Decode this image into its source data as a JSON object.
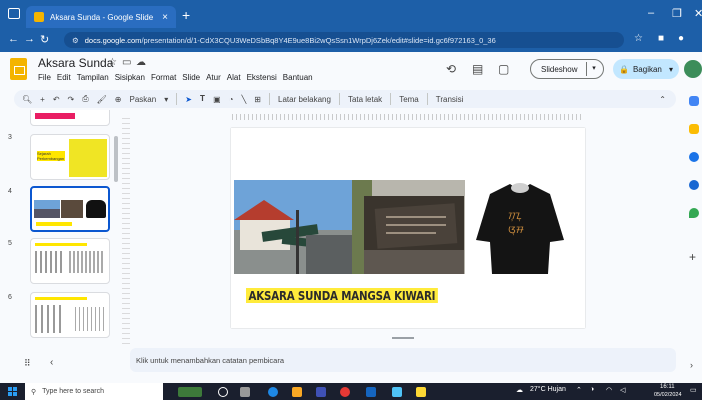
{
  "browser": {
    "tab_title": "Aksara Sunda - Google Slide",
    "tab_close": "×",
    "new_tab": "+",
    "url_domain": "docs.google.com",
    "url_path": "/presentation/d/1-CdX3CQU3WeDSbBq8Y4E9ue8Bi2wQsSsn1WrpDj6Zek/edit#slide=id.gc6f972163_0_36",
    "minimize": "–",
    "maximize": "❐",
    "close": "✕"
  },
  "doc": {
    "title": "Aksara Sunda",
    "menus": [
      "File",
      "Edit",
      "Tampilan",
      "Sisipkan",
      "Format",
      "Slide",
      "Atur",
      "Alat",
      "Ekstensi",
      "Bantuan"
    ],
    "slideshow_label": "Slideshow",
    "share_label": "Bagikan"
  },
  "toolbar": {
    "zoom_label": "Paskan",
    "background_label": "Latar belakang",
    "layout_label": "Tata letak",
    "theme_label": "Tema",
    "transition_label": "Transisi"
  },
  "filmstrip": {
    "slide_numbers": [
      "3",
      "4",
      "5",
      "6"
    ],
    "slide3_text": "Sejarah Perkembangan"
  },
  "slide": {
    "title": "AKSARA SUNDA MANGSA KIWARI",
    "shirt_text_line1": "ᮊᮥᮔᮥ",
    "shirt_text_line2": "ᮃᮥᮞ"
  },
  "notes": {
    "placeholder": "Klik untuk menambahkan catatan pembicara"
  },
  "taskbar": {
    "search_placeholder": "Type here to search",
    "weather": "27°C Hujan",
    "time": "16:11",
    "date": "05/02/2024"
  }
}
